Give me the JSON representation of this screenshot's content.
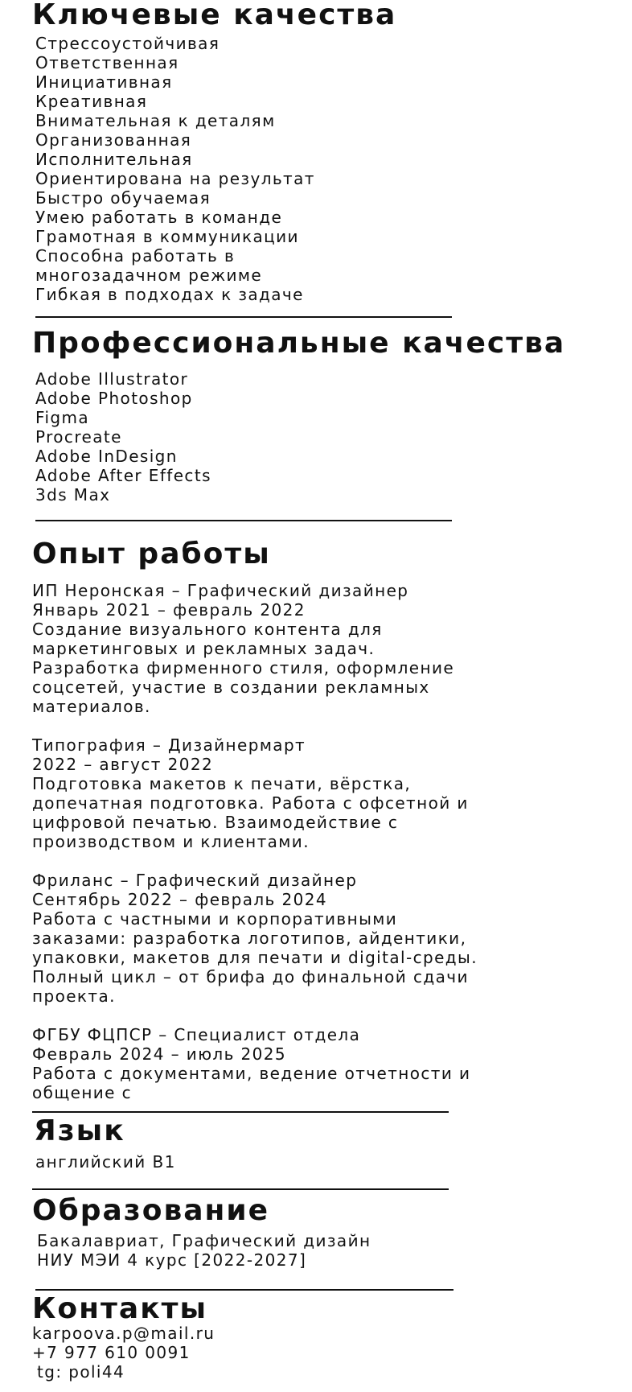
{
  "key_qualities": {
    "title": "Ключевые качества",
    "items": [
      "Стрессоустойчивая",
      "Ответственная",
      "Инициативная",
      "Креативная",
      "Внимательная к деталям",
      "Организованная",
      "Исполнительная",
      "Ориентирована на результат",
      "Быстро обучаемая",
      "Умею работать в команде",
      "Грамотная в коммуникации",
      "Способна работать в",
      "многозадачном режиме",
      "Гибкая в подходах к задаче"
    ]
  },
  "professional_qualities": {
    "title": "Профессиональные качества",
    "items": [
      "Adobe Illustrator",
      "Adobe Photoshop",
      "Figma",
      "Procreate",
      "Adobe InDesign",
      "Adobe After Effects",
      "3ds Max"
    ]
  },
  "experience": {
    "title": "Опыт работы",
    "jobs": [
      {
        "position": "ИП Неронская – Графический дизайнер",
        "period": "Январь 2021 – февраль 2022",
        "description": "Создание визуального контента для маркетинговых и рекламных задач. Разработка фирменного стиля, оформление соцсетей, участие в создании рекламных материалов."
      },
      {
        "position": "Типография – Дизайнермарт",
        "period": "2022 – август 2022",
        "description": "Подготовка макетов к печати, вёрстка, допечатная подготовка. Работа с офсетной и цифровой печатью. Взаимодействие с производством и клиентами."
      },
      {
        "position": "Фриланс – Графический дизайнер",
        "period": "Сентябрь 2022 – февраль 2024",
        "description": "Работа с частными и корпоративными заказами: разработка логотипов, айдентики, упаковки, макетов для печати и digital-среды. Полный цикл – от брифа до финальной сдачи проекта."
      },
      {
        "position": "ФГБУ ФЦПСР – Специалист отдела",
        "period": "Февраль 2024 – июль 2025",
        "description": "Работа с документами, ведение отчетности и общение с"
      }
    ]
  },
  "language": {
    "title": "Язык",
    "value": "английский B1"
  },
  "education": {
    "title": "Образование",
    "degree": "Бакалавриат, Графический дизайн",
    "institution": "НИУ МЭИ 4 курс [2022-2027]"
  },
  "contacts": {
    "title": "Контакты",
    "email": "karpoova.p@mail.ru",
    "phone": "+7 977 610 0091",
    "telegram": "tg: poli44"
  }
}
